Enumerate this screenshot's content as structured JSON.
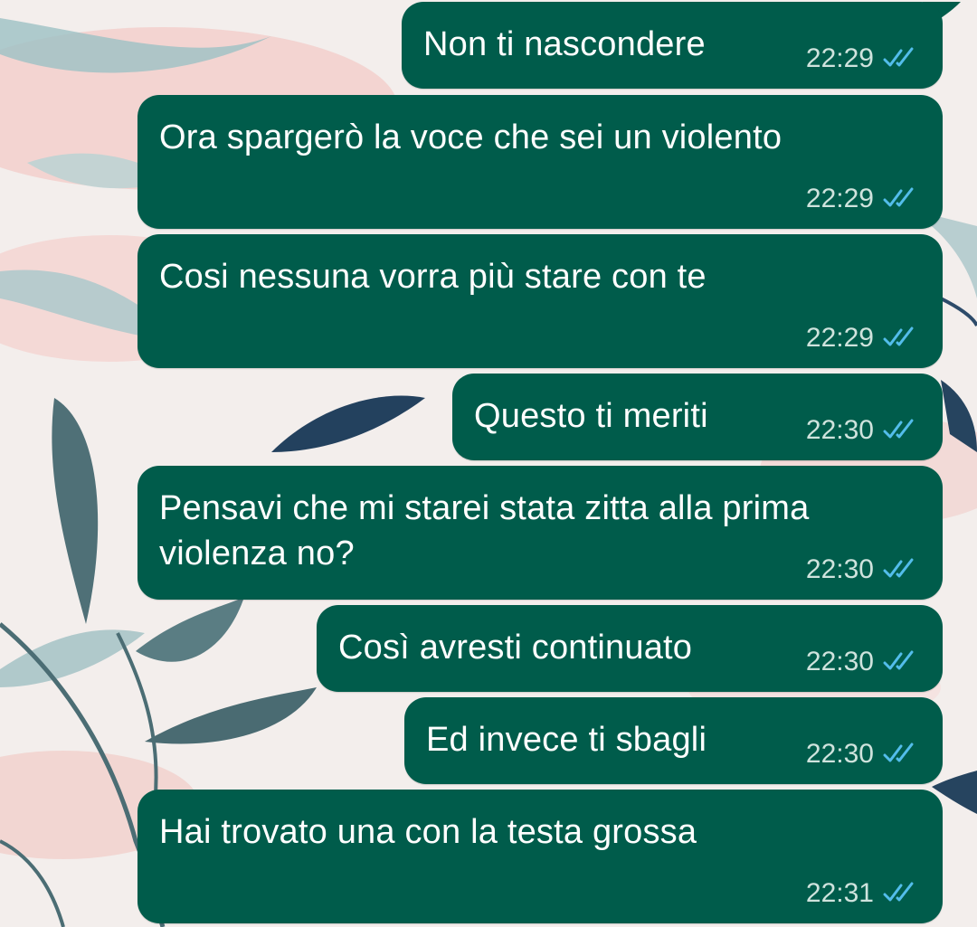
{
  "chat": {
    "messages": [
      {
        "text": "Non ti nascondere",
        "time": "22:29",
        "status_icon": "double-check-read-icon"
      },
      {
        "text": "Ora spargerò la voce che sei un violento",
        "time": "22:29",
        "status_icon": "double-check-read-icon"
      },
      {
        "text": "Cosi nessuna vorra più stare con te",
        "time": "22:29",
        "status_icon": "double-check-read-icon"
      },
      {
        "text": "Questo ti meriti",
        "time": "22:30",
        "status_icon": "double-check-read-icon"
      },
      {
        "text": "Pensavi che mi starei stata zitta alla prima\nviolenza no?",
        "time": "22:30",
        "status_icon": "double-check-read-icon"
      },
      {
        "text": "Così avresti continuato",
        "time": "22:30",
        "status_icon": "double-check-read-icon"
      },
      {
        "text": "Ed invece ti sbagli",
        "time": "22:30",
        "status_icon": "double-check-read-icon"
      },
      {
        "text": "Hai trovato una con la testa grossa",
        "time": "22:31",
        "status_icon": "double-check-read-icon"
      }
    ]
  },
  "colors": {
    "bubble": "#005c4b",
    "text": "#ffffff",
    "time": "#cfe3dd",
    "read_ticks": "#53bdeb",
    "wallpaper": "#f3eeec"
  }
}
